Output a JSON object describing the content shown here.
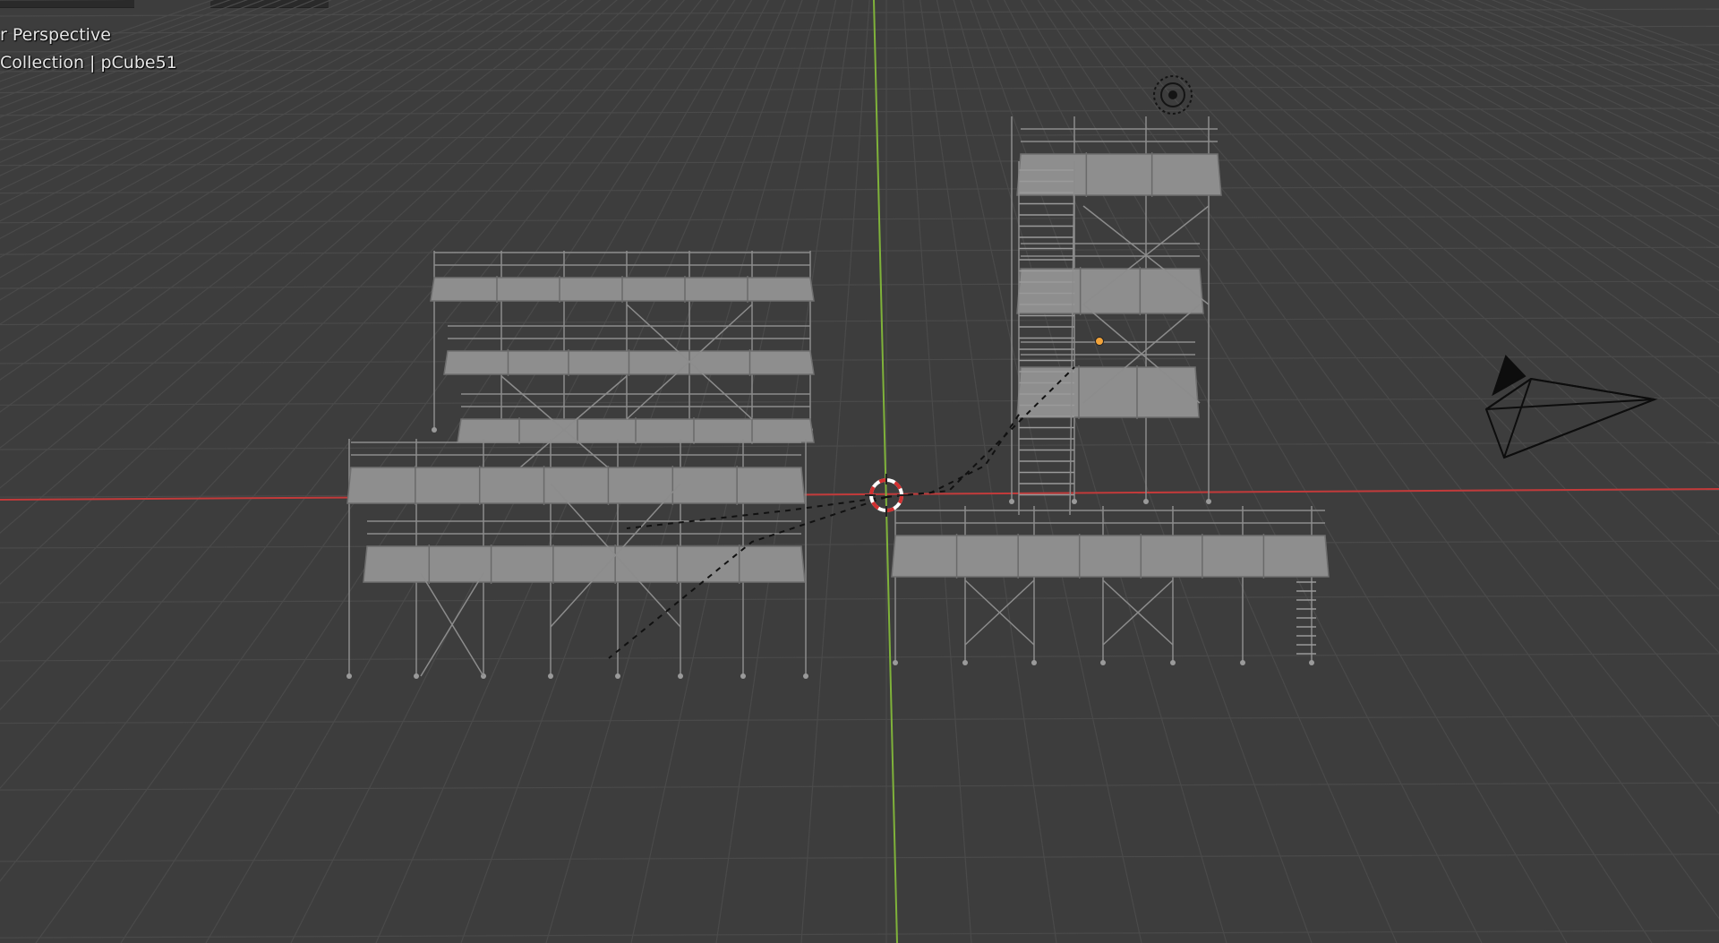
{
  "viewport": {
    "view_mode_label": "r Perspective",
    "collection_label": "Collection | pCube51",
    "grid_color": "#4a4a4a",
    "background_color": "#3d3d3d",
    "x_axis_color": "#c23a3a",
    "y_axis_color": "#7fb23a",
    "structure_color": "#8c8c8c",
    "deck_color": "#8e8e8e",
    "selection_dot_color": "#f2a33a"
  },
  "objects": {
    "camera": "camera-icon",
    "light": "light-icon",
    "cursor": "3d-cursor-icon",
    "origin": "origin-dot-icon"
  }
}
